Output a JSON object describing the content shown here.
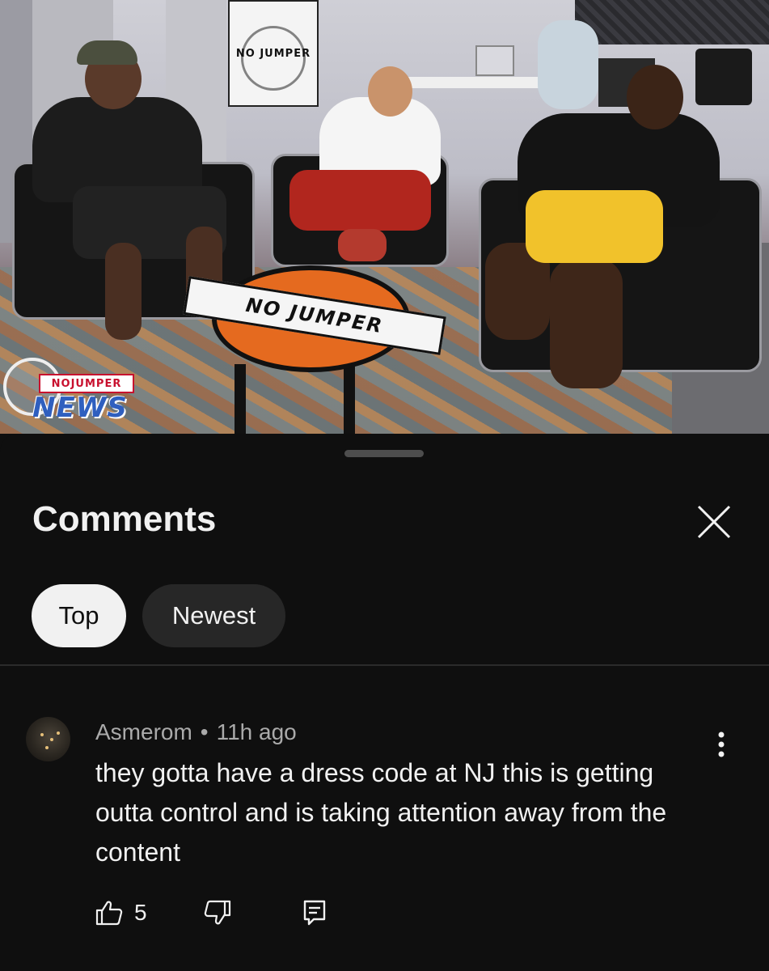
{
  "video": {
    "poster_text": "NO JUMPER",
    "table_banner_text": "NO JUMPER",
    "watermark": {
      "line1": "NOJUMPER",
      "line2": "NEWS"
    }
  },
  "comments_panel": {
    "title": "Comments",
    "close_icon": "close-icon",
    "filters": [
      {
        "label": "Top",
        "selected": true
      },
      {
        "label": "Newest",
        "selected": false
      }
    ]
  },
  "comment": {
    "author": "Asmerom",
    "separator": "•",
    "time": "11h ago",
    "text": "they gotta have a dress code at NJ this is getting outta control and is taking attention away from the content",
    "likes": "5",
    "icons": {
      "like": "thumbs-up-icon",
      "dislike": "thumbs-down-icon",
      "reply": "reply-icon",
      "more": "more-vertical-icon"
    }
  },
  "colors": {
    "background": "#0f0f0f",
    "chip_selected_bg": "#f1f1f1",
    "chip_unselected_bg": "#272727",
    "secondary_text": "#aaaaaa",
    "primary_text": "#f1f1f1"
  }
}
